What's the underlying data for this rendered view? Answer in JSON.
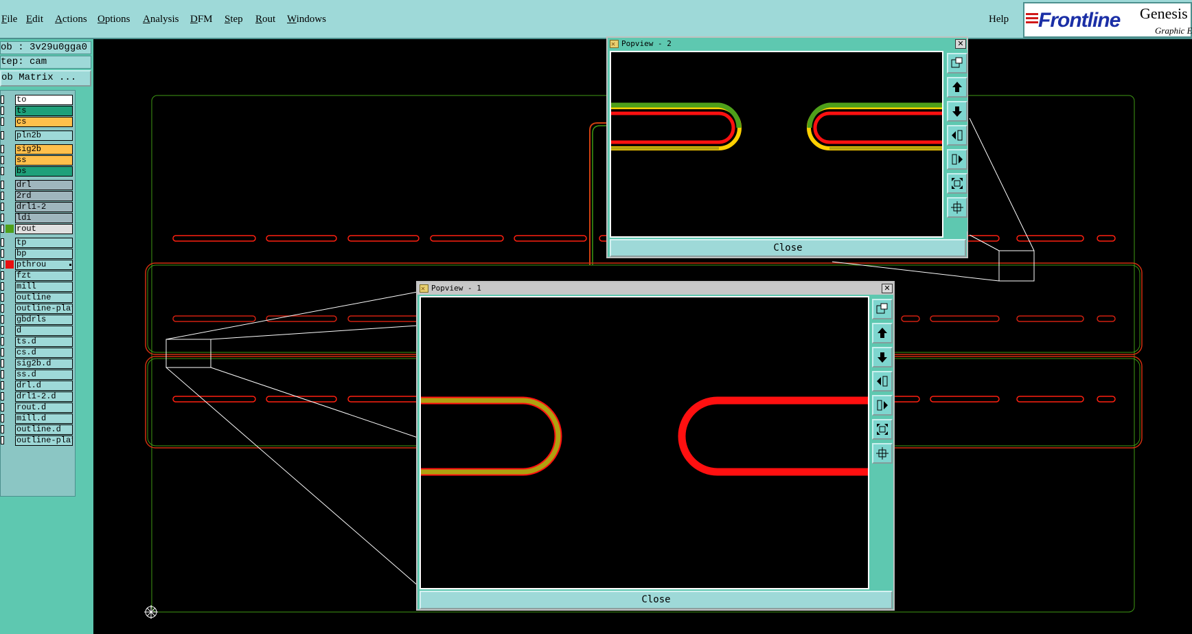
{
  "menubar": {
    "items": [
      {
        "label": "File",
        "ul": "F"
      },
      {
        "label": "Edit",
        "ul": "E"
      },
      {
        "label": "Actions",
        "ul": "A"
      },
      {
        "label": "Options",
        "ul": "O"
      },
      {
        "label": "Analysis",
        "ul": "A"
      },
      {
        "label": "DFM",
        "ul": "D"
      },
      {
        "label": "Step",
        "ul": "S"
      },
      {
        "label": "Rout",
        "ul": "R"
      },
      {
        "label": "Windows",
        "ul": "W"
      }
    ],
    "help": "Help"
  },
  "brand": {
    "logo": "Frontline",
    "app": "Genesis",
    "sub": "Graphic E"
  },
  "left_panel": {
    "job": "ob : 3v29u0gga0",
    "step": "tep: cam",
    "matrix_button": "ob Matrix ...",
    "layers": [
      {
        "name": "to",
        "color": "#ffffff",
        "swatch": ""
      },
      {
        "name": "ts",
        "color": "#1fa07a",
        "swatch": ""
      },
      {
        "name": "cs",
        "color": "#ffc04c",
        "swatch": ""
      },
      {
        "name": "pln2b",
        "color": "#9ed9d8",
        "swatch": ""
      },
      {
        "name": "sig2b",
        "color": "#ffc04c",
        "swatch": ""
      },
      {
        "name": "ss",
        "color": "#ffc04c",
        "swatch": ""
      },
      {
        "name": "bs",
        "color": "#1fa07a",
        "swatch": ""
      },
      {
        "name": "drl",
        "color": "#9fb6bd",
        "swatch": ""
      },
      {
        "name": "2rd",
        "color": "#9fb6bd",
        "swatch": ""
      },
      {
        "name": "drl1-2",
        "color": "#9fb6bd",
        "swatch": ""
      },
      {
        "name": "ldi",
        "color": "#9fb6bd",
        "swatch": ""
      },
      {
        "name": "rout",
        "color": "#e0e0e0",
        "swatch": "#4ea01a"
      },
      {
        "name": "tp",
        "color": "#9ed9d8",
        "swatch": ""
      },
      {
        "name": "bp",
        "color": "#9ed9d8",
        "swatch": ""
      },
      {
        "name": "pthrou",
        "color": "#9ed9d8",
        "swatch": "#e81010",
        "dot": true
      },
      {
        "name": "fzt",
        "color": "#9ed9d8",
        "swatch": ""
      },
      {
        "name": "mill",
        "color": "#9ed9d8",
        "swatch": ""
      },
      {
        "name": "outline",
        "color": "#9ed9d8",
        "swatch": ""
      },
      {
        "name": "outline-plat",
        "color": "#9ed9d8",
        "swatch": ""
      },
      {
        "name": "gbdrls",
        "color": "#9ed9d8",
        "swatch": ""
      },
      {
        "name": "d",
        "color": "#9ed9d8",
        "swatch": ""
      },
      {
        "name": "ts.d",
        "color": "#9ed9d8",
        "swatch": ""
      },
      {
        "name": "cs.d",
        "color": "#9ed9d8",
        "swatch": ""
      },
      {
        "name": "sig2b.d",
        "color": "#9ed9d8",
        "swatch": ""
      },
      {
        "name": "ss.d",
        "color": "#9ed9d8",
        "swatch": ""
      },
      {
        "name": "drl.d",
        "color": "#9ed9d8",
        "swatch": ""
      },
      {
        "name": "drl1-2.d",
        "color": "#9ed9d8",
        "swatch": ""
      },
      {
        "name": "rout.d",
        "color": "#9ed9d8",
        "swatch": ""
      },
      {
        "name": "mill.d",
        "color": "#9ed9d8",
        "swatch": ""
      },
      {
        "name": "outline.d",
        "color": "#9ed9d8",
        "swatch": ""
      },
      {
        "name": "outline-plat",
        "color": "#9ed9d8",
        "swatch": ""
      }
    ]
  },
  "popview1": {
    "title": "Popview - 1",
    "close_label": "Close",
    "close_icon": "close-x-icon"
  },
  "popview2": {
    "title": "Popview - 2",
    "close_label": "Close",
    "close_icon": "close-x-icon"
  },
  "toolbar_icons": [
    "zoom-window-icon",
    "pan-up-icon",
    "pan-down-icon",
    "pan-left-icon",
    "pan-right-icon",
    "zoom-in-icon",
    "zoom-out-icon"
  ],
  "colors": {
    "menubar_bg": "#9ed9d8",
    "panel_bg": "#5ec8b0",
    "rout_red": "#ff1010",
    "rout_green": "#4ea01a",
    "rout_olive": "#b0a010"
  }
}
